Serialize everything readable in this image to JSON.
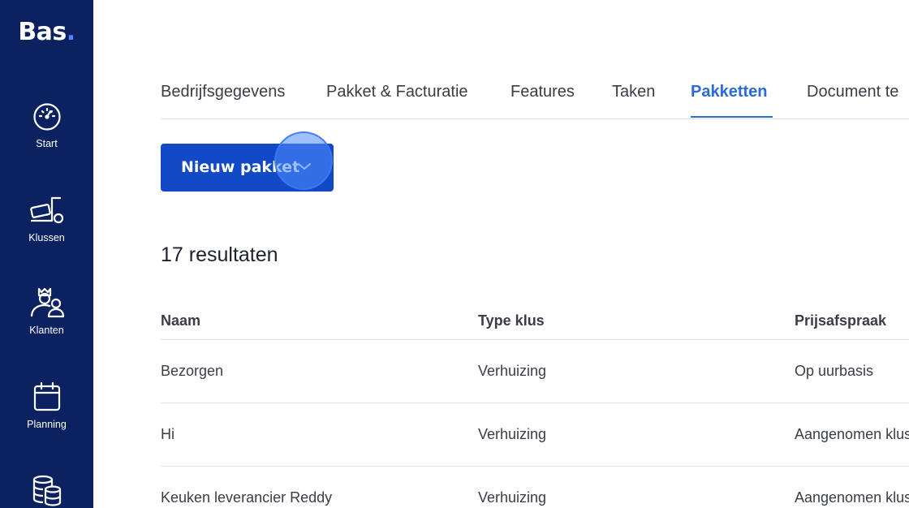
{
  "app": {
    "logo_text": "Bas",
    "logo_dot": "."
  },
  "sidebar": {
    "items": [
      {
        "label": "Start",
        "icon": "gauge-icon"
      },
      {
        "label": "Klussen",
        "icon": "moving-dolly-icon"
      },
      {
        "label": "Klanten",
        "icon": "customers-icon"
      },
      {
        "label": "Planning",
        "icon": "calendar-icon"
      },
      {
        "label": "",
        "icon": "database-icon"
      }
    ]
  },
  "tabs": [
    {
      "label": "Bedrijfsgegevens",
      "active": false
    },
    {
      "label": "Pakket & Facturatie",
      "active": false
    },
    {
      "label": "Features",
      "active": false
    },
    {
      "label": "Taken",
      "active": false
    },
    {
      "label": "Pakketten",
      "active": true
    },
    {
      "label": "Document te",
      "active": false
    }
  ],
  "new_package_button": {
    "label": "Nieuw pakket"
  },
  "results_label": "17 resultaten",
  "table": {
    "columns": [
      "Naam",
      "Type klus",
      "Prijsafspraak"
    ],
    "rows": [
      [
        "Bezorgen",
        "Verhuizing",
        "Op uurbasis"
      ],
      [
        "Hi",
        "Verhuizing",
        "Aangenomen klus"
      ],
      [
        "Keuken leverancier Reddy",
        "Verhuizing",
        "Aangenomen klus"
      ]
    ]
  },
  "colors": {
    "sidebar_bg": "#0b2160",
    "accent": "#2a6ad9",
    "button_bg": "#1149c7"
  }
}
